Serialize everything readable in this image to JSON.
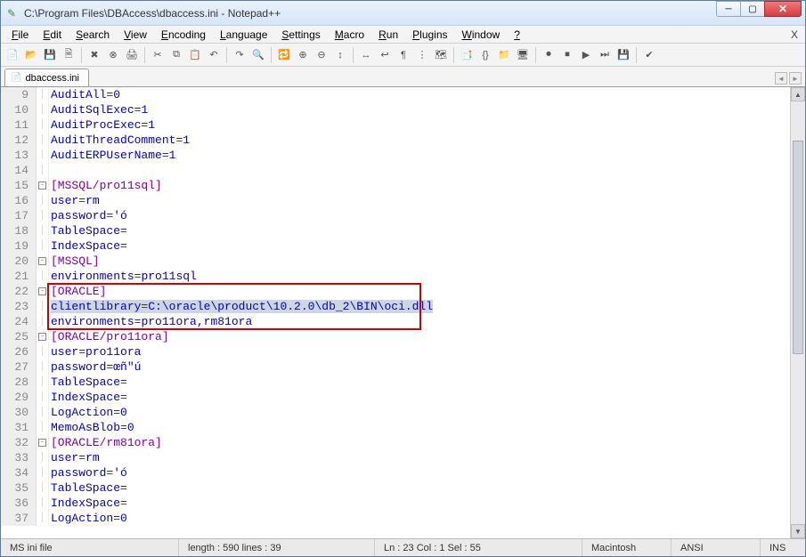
{
  "title": "C:\\Program Files\\DBAccess\\dbaccess.ini - Notepad++",
  "menu": [
    "File",
    "Edit",
    "Search",
    "View",
    "Encoding",
    "Language",
    "Settings",
    "Macro",
    "Run",
    "Plugins",
    "Window",
    "?"
  ],
  "tab": {
    "label": "dbaccess.ini"
  },
  "toolbar_icons": [
    "new-file-icon",
    "open-file-icon",
    "save-icon",
    "save-all-icon",
    "close-icon",
    "close-all-icon",
    "print-icon",
    "cut-icon",
    "copy-icon",
    "paste-icon",
    "undo-icon",
    "redo-icon",
    "find-icon",
    "replace-icon",
    "zoom-in-icon",
    "zoom-out-icon",
    "sync-v-icon",
    "sync-h-icon",
    "wrap-icon",
    "all-chars-icon",
    "indent-guide-icon",
    "lang-icon",
    "doc-map-icon",
    "func-list-icon",
    "folder-icon",
    "monitor-icon",
    "record-icon",
    "stop-icon",
    "play-icon",
    "play-multi-icon",
    "save-macro-icon",
    "spell-icon"
  ],
  "lines": [
    {
      "n": 9,
      "fold": "",
      "code": [
        {
          "t": "AuditAll",
          "c": "kw"
        },
        {
          "t": "=",
          "c": "op"
        },
        {
          "t": "0",
          "c": "kw"
        }
      ]
    },
    {
      "n": 10,
      "fold": "",
      "code": [
        {
          "t": "AuditSqlExec",
          "c": "kw"
        },
        {
          "t": "=",
          "c": "op"
        },
        {
          "t": "1",
          "c": "kw"
        }
      ]
    },
    {
      "n": 11,
      "fold": "",
      "code": [
        {
          "t": "AuditProcExec",
          "c": "kw"
        },
        {
          "t": "=",
          "c": "op"
        },
        {
          "t": "1",
          "c": "kw"
        }
      ]
    },
    {
      "n": 12,
      "fold": "",
      "code": [
        {
          "t": "AuditThreadComment",
          "c": "kw"
        },
        {
          "t": "=",
          "c": "op"
        },
        {
          "t": "1",
          "c": "kw"
        }
      ]
    },
    {
      "n": 13,
      "fold": "",
      "code": [
        {
          "t": "AuditERPUserName",
          "c": "kw"
        },
        {
          "t": "=",
          "c": "op"
        },
        {
          "t": "1",
          "c": "kw"
        }
      ]
    },
    {
      "n": 14,
      "fold": "",
      "code": []
    },
    {
      "n": 15,
      "fold": "minus",
      "code": [
        {
          "t": "[MSSQL/pro11sql]",
          "c": "section"
        }
      ]
    },
    {
      "n": 16,
      "fold": "",
      "code": [
        {
          "t": "user",
          "c": "kw"
        },
        {
          "t": "=",
          "c": "op"
        },
        {
          "t": "rm",
          "c": "kw"
        }
      ]
    },
    {
      "n": 17,
      "fold": "",
      "code": [
        {
          "t": "password",
          "c": "kw"
        },
        {
          "t": "=",
          "c": "op"
        },
        {
          "t": "'ó",
          "c": "kw"
        }
      ]
    },
    {
      "n": 18,
      "fold": "",
      "code": [
        {
          "t": "TableSpace",
          "c": "kw"
        },
        {
          "t": "=",
          "c": "op"
        }
      ]
    },
    {
      "n": 19,
      "fold": "",
      "code": [
        {
          "t": "IndexSpace",
          "c": "kw"
        },
        {
          "t": "=",
          "c": "op"
        }
      ]
    },
    {
      "n": 20,
      "fold": "minus",
      "code": [
        {
          "t": "[MSSQL]",
          "c": "section"
        }
      ]
    },
    {
      "n": 21,
      "fold": "",
      "code": [
        {
          "t": "environments",
          "c": "kw"
        },
        {
          "t": "=",
          "c": "op"
        },
        {
          "t": "pro11sql",
          "c": "kw"
        }
      ]
    },
    {
      "n": 22,
      "fold": "minus",
      "code": [
        {
          "t": "[ORACLE]",
          "c": "section"
        }
      ],
      "boxed": true
    },
    {
      "n": 23,
      "fold": "",
      "code": [
        {
          "t": "clientlibrary",
          "c": "kw",
          "sel": true
        },
        {
          "t": "=",
          "c": "op",
          "sel": true
        },
        {
          "t": "C:\\oracle\\product\\10.2.0\\db_2\\BIN\\oci.dll",
          "c": "kw",
          "sel": true
        }
      ],
      "boxed": true
    },
    {
      "n": 24,
      "fold": "",
      "code": [
        {
          "t": "environments",
          "c": "kw"
        },
        {
          "t": "=",
          "c": "op"
        },
        {
          "t": "pro11ora,rm81ora",
          "c": "kw"
        }
      ],
      "boxed": true
    },
    {
      "n": 25,
      "fold": "minus",
      "code": [
        {
          "t": "[ORACLE/pro11ora]",
          "c": "section"
        }
      ]
    },
    {
      "n": 26,
      "fold": "",
      "code": [
        {
          "t": "user",
          "c": "kw"
        },
        {
          "t": "=",
          "c": "op"
        },
        {
          "t": "pro11ora",
          "c": "kw"
        }
      ]
    },
    {
      "n": 27,
      "fold": "",
      "code": [
        {
          "t": "password",
          "c": "kw"
        },
        {
          "t": "=",
          "c": "op"
        },
        {
          "t": "œñ\"ú",
          "c": "kw"
        }
      ]
    },
    {
      "n": 28,
      "fold": "",
      "code": [
        {
          "t": "TableSpace",
          "c": "kw"
        },
        {
          "t": "=",
          "c": "op"
        }
      ]
    },
    {
      "n": 29,
      "fold": "",
      "code": [
        {
          "t": "IndexSpace",
          "c": "kw"
        },
        {
          "t": "=",
          "c": "op"
        }
      ]
    },
    {
      "n": 30,
      "fold": "",
      "code": [
        {
          "t": "LogAction",
          "c": "kw"
        },
        {
          "t": "=",
          "c": "op"
        },
        {
          "t": "0",
          "c": "kw"
        }
      ]
    },
    {
      "n": 31,
      "fold": "",
      "code": [
        {
          "t": "MemoAsBlob",
          "c": "kw"
        },
        {
          "t": "=",
          "c": "op"
        },
        {
          "t": "0",
          "c": "kw"
        }
      ]
    },
    {
      "n": 32,
      "fold": "minus",
      "code": [
        {
          "t": "[ORACLE/rm81ora]",
          "c": "section"
        }
      ]
    },
    {
      "n": 33,
      "fold": "",
      "code": [
        {
          "t": "user",
          "c": "kw"
        },
        {
          "t": "=",
          "c": "op"
        },
        {
          "t": "rm",
          "c": "kw"
        }
      ]
    },
    {
      "n": 34,
      "fold": "",
      "code": [
        {
          "t": "password",
          "c": "kw"
        },
        {
          "t": "=",
          "c": "op"
        },
        {
          "t": "'ó",
          "c": "kw"
        }
      ]
    },
    {
      "n": 35,
      "fold": "",
      "code": [
        {
          "t": "TableSpace",
          "c": "kw"
        },
        {
          "t": "=",
          "c": "op"
        }
      ]
    },
    {
      "n": 36,
      "fold": "",
      "code": [
        {
          "t": "IndexSpace",
          "c": "kw"
        },
        {
          "t": "=",
          "c": "op"
        }
      ]
    },
    {
      "n": 37,
      "fold": "",
      "code": [
        {
          "t": "LogAction",
          "c": "kw"
        },
        {
          "t": "=",
          "c": "op"
        },
        {
          "t": "0",
          "c": "kw"
        }
      ]
    }
  ],
  "highlight_box": {
    "first_line_idx": 13,
    "last_line_idx": 15
  },
  "status": {
    "lang": "MS ini file",
    "length": "length : 590    lines : 39",
    "pos": "Ln : 23    Col : 1    Sel : 55",
    "eol": "Macintosh",
    "enc": "ANSI",
    "ovr": "INS"
  }
}
